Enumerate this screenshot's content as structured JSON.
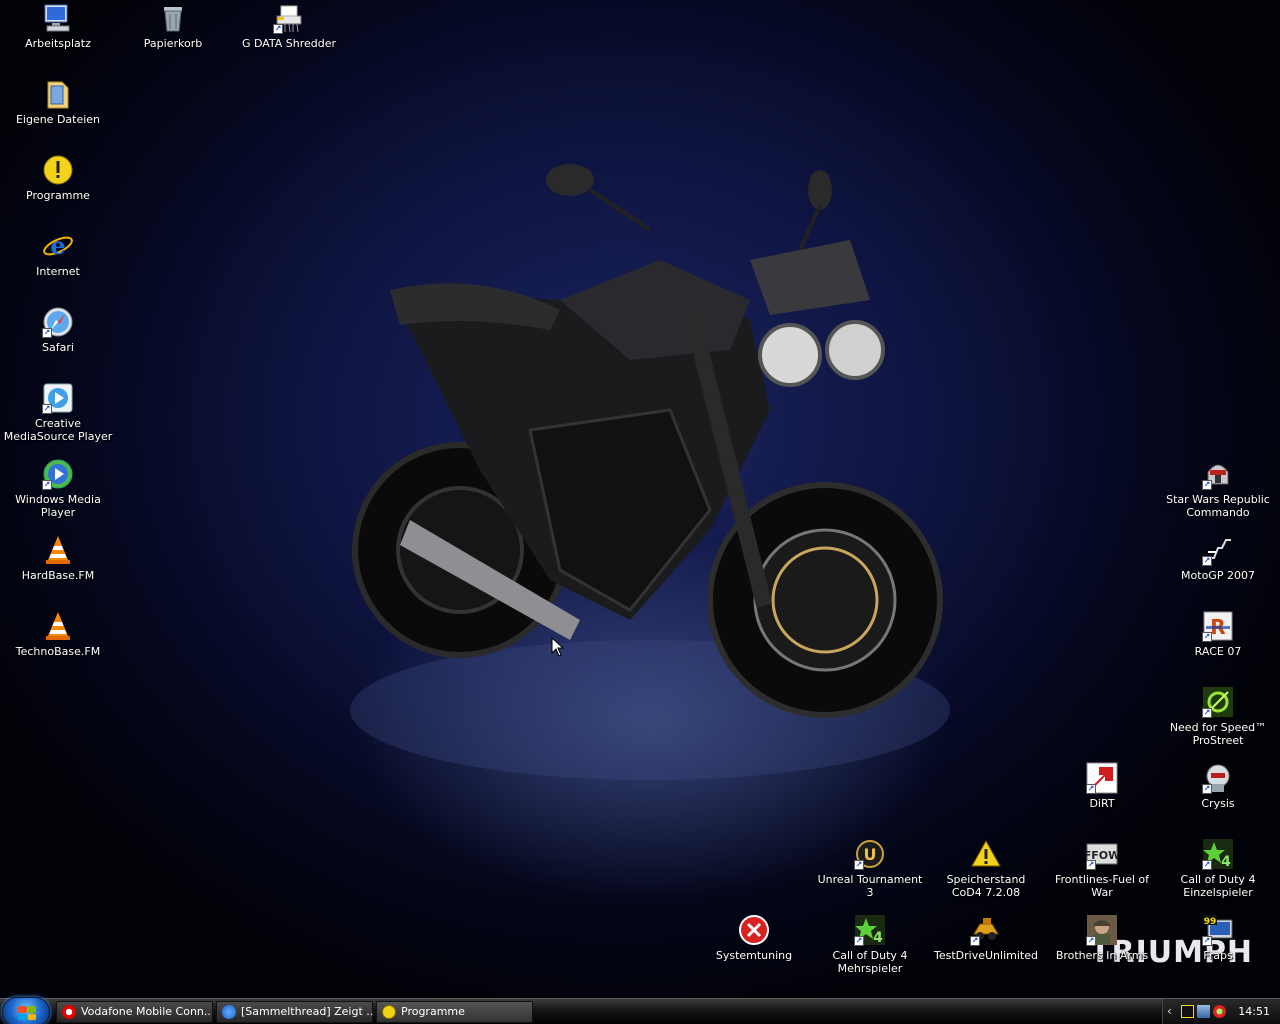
{
  "desktop_icons": [
    {
      "id": "arbeitsplatz",
      "label": "Arbeitsplatz",
      "icon": "computer-icon"
    },
    {
      "id": "papierkorb",
      "label": "Papierkorb",
      "icon": "recycle-bin-icon"
    },
    {
      "id": "gdata",
      "label": "G DATA Shredder",
      "icon": "shredder-icon"
    },
    {
      "id": "eigene",
      "label": "Eigene Dateien",
      "icon": "folder-icon"
    },
    {
      "id": "programme",
      "label": "Programme",
      "icon": "warning-icon"
    },
    {
      "id": "internet",
      "label": "Internet",
      "icon": "internet-explorer-icon"
    },
    {
      "id": "safari",
      "label": "Safari",
      "icon": "safari-icon"
    },
    {
      "id": "creative",
      "label": "Creative MediaSource Player",
      "icon": "media-player-icon"
    },
    {
      "id": "wmp",
      "label": "Windows Media Player",
      "icon": "windows-media-player-icon"
    },
    {
      "id": "hardbase",
      "label": "HardBase.FM",
      "icon": "vlc-cone-icon"
    },
    {
      "id": "technobase",
      "label": "TechnoBase.FM",
      "icon": "vlc-cone-icon"
    },
    {
      "id": "swrc",
      "label": "Star Wars Republic Commando",
      "icon": "trooper-helmet-icon"
    },
    {
      "id": "motogp",
      "label": "MotoGP 2007",
      "icon": "motogp-icon"
    },
    {
      "id": "race07",
      "label": "RACE 07",
      "icon": "race-icon"
    },
    {
      "id": "nfs",
      "label": "Need for Speed™ ProStreet",
      "icon": "nfs-icon"
    },
    {
      "id": "dirt",
      "label": "DiRT",
      "icon": "dirt-icon"
    },
    {
      "id": "crysis",
      "label": "Crysis",
      "icon": "crysis-icon"
    },
    {
      "id": "ut3",
      "label": "Unreal Tournament 3",
      "icon": "unreal-icon"
    },
    {
      "id": "speicherstand",
      "label": "Speicherstand CoD4 7.2.08",
      "icon": "warning-icon"
    },
    {
      "id": "ffow",
      "label": "Frontlines-Fuel of War",
      "icon": "ffow-icon"
    },
    {
      "id": "cod4sp",
      "label": "Call of Duty 4 Einzelspieler",
      "icon": "cod4-icon"
    },
    {
      "id": "systemtuning",
      "label": "Systemtuning",
      "icon": "error-icon"
    },
    {
      "id": "cod4mp",
      "label": "Call of Duty 4 Mehrspieler",
      "icon": "cod4-icon"
    },
    {
      "id": "tdu",
      "label": "TestDriveUnlimited",
      "icon": "tdu-icon"
    },
    {
      "id": "bia",
      "label": "Brothers In Arms",
      "icon": "soldier-icon"
    },
    {
      "id": "fraps",
      "label": "Fraps",
      "icon": "fraps-icon"
    }
  ],
  "wallpaper": {
    "logo_text": "TRIUMPH"
  },
  "taskbar": {
    "tasks": [
      {
        "label": "Vodafone Mobile Conn...",
        "icon": "vodafone-icon"
      },
      {
        "label": "[Sammelthread] Zeigt ...",
        "icon": "internet-explorer-icon"
      },
      {
        "label": "Programme",
        "icon": "warning-icon"
      }
    ],
    "tray": {
      "clock": "14:51",
      "expand_glyph": "‹"
    }
  },
  "colors": {
    "desktop_bg": "#0e1440",
    "taskbar_bg": "#151515",
    "icon_label": "#ffffff"
  }
}
